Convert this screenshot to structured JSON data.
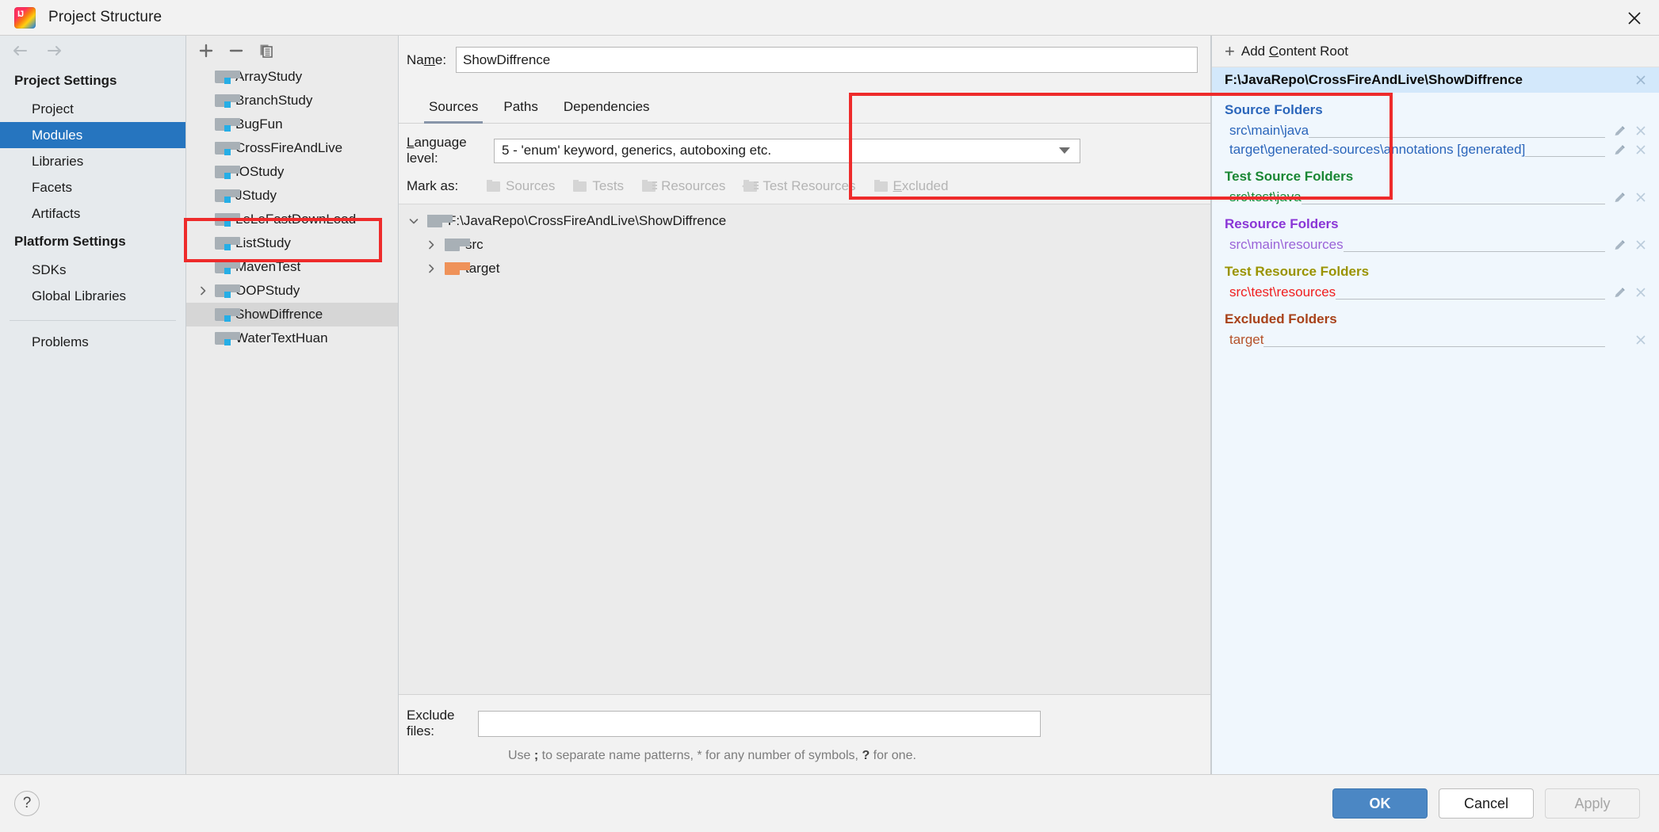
{
  "window": {
    "title": "Project Structure",
    "app_icon": "intellij-idea-icon",
    "close_icon": "close-icon"
  },
  "sidebar": {
    "nav": {
      "back_icon": "arrow-left-icon",
      "forward_icon": "arrow-right-icon"
    },
    "groups": [
      {
        "title": "Project Settings",
        "items": [
          {
            "label": "Project",
            "selected": false
          },
          {
            "label": "Modules",
            "selected": true
          },
          {
            "label": "Libraries",
            "selected": false
          },
          {
            "label": "Facets",
            "selected": false
          },
          {
            "label": "Artifacts",
            "selected": false
          }
        ]
      },
      {
        "title": "Platform Settings",
        "items": [
          {
            "label": "SDKs",
            "selected": false
          },
          {
            "label": "Global Libraries",
            "selected": false
          }
        ]
      }
    ],
    "problems": {
      "label": "Problems"
    }
  },
  "modules_panel": {
    "toolbar": [
      {
        "name": "add-module-button",
        "icon": "plus-icon"
      },
      {
        "name": "remove-module-button",
        "icon": "minus-icon"
      },
      {
        "name": "copy-module-button",
        "icon": "copy-icon"
      }
    ],
    "items": [
      {
        "label": "ArrayStudy",
        "expandable": false,
        "selected": false
      },
      {
        "label": "BranchStudy",
        "expandable": false,
        "selected": false
      },
      {
        "label": "BugFun",
        "expandable": false,
        "selected": false
      },
      {
        "label": "CrossFireAndLive",
        "expandable": false,
        "selected": false
      },
      {
        "label": "IOStudy",
        "expandable": false,
        "selected": false
      },
      {
        "label": "JStudy",
        "expandable": false,
        "selected": false
      },
      {
        "label": "LeLeFastDownLoad",
        "expandable": false,
        "selected": false
      },
      {
        "label": "ListStudy",
        "expandable": false,
        "selected": false
      },
      {
        "label": "MavenTest",
        "expandable": false,
        "selected": false
      },
      {
        "label": "OOPStudy",
        "expandable": true,
        "selected": false
      },
      {
        "label": "ShowDiffrence",
        "expandable": false,
        "selected": true
      },
      {
        "label": "WaterTextHuan",
        "expandable": false,
        "selected": false
      }
    ]
  },
  "center": {
    "name_label": "Name:",
    "name_value": "ShowDiffrence",
    "tabs": [
      {
        "label": "Sources",
        "active": true
      },
      {
        "label": "Paths",
        "active": false
      },
      {
        "label": "Dependencies",
        "active": false
      }
    ],
    "language_level_label": "Language level:",
    "language_level_value": "5 - 'enum' keyword, generics, autoboxing etc.",
    "mark_as_label": "Mark as:",
    "mark_as_options": [
      {
        "label": "Sources",
        "icon": "folder-sources-icon"
      },
      {
        "label": "Tests",
        "icon": "folder-tests-icon"
      },
      {
        "label": "Resources",
        "icon": "folder-resources-icon"
      },
      {
        "label": "Test Resources",
        "icon": "folder-test-resources-icon"
      },
      {
        "label": "Excluded",
        "icon": "folder-excluded-icon"
      }
    ],
    "tree": [
      {
        "label": "F:\\JavaRepo\\CrossFireAndLive\\ShowDiffrence",
        "depth": 0,
        "expanded": true,
        "icon": "folder-icon",
        "color": "gray"
      },
      {
        "label": "src",
        "depth": 1,
        "expanded": false,
        "icon": "folder-icon",
        "color": "gray"
      },
      {
        "label": "target",
        "depth": 1,
        "expanded": false,
        "icon": "folder-excluded-icon",
        "color": "orange"
      }
    ],
    "exclude_files_label": "Exclude files:",
    "exclude_files_value": "",
    "exclude_hint_a": "Use ",
    "exclude_hint_semicolon": ";",
    "exclude_hint_b": " to separate name patterns, * for any number of symbols, ",
    "exclude_hint_q": "?",
    "exclude_hint_c": " for one."
  },
  "right_panel": {
    "add_content_root": "Add Content Root",
    "add_icon": "plus-icon",
    "content_root": "F:\\JavaRepo\\CrossFireAndLive\\ShowDiffrence",
    "groups": [
      {
        "title": "Source Folders",
        "color": "#2b66bb",
        "entries": [
          {
            "path": "src\\main\\java",
            "color": "#2b66bb",
            "has_edit": true,
            "has_remove": true
          },
          {
            "path": "target\\generated-sources\\annotations [generated]",
            "color": "#2b66bb",
            "has_edit": true,
            "has_remove": true
          }
        ]
      },
      {
        "title": "Test Source Folders",
        "color": "#1a8734",
        "entries": [
          {
            "path": "src\\test\\java",
            "color": "#1a8734",
            "has_edit": true,
            "has_remove": true
          }
        ]
      },
      {
        "title": "Resource Folders",
        "color": "#8a35d6",
        "entries": [
          {
            "path": "src\\main\\resources",
            "color": "#9a63d8",
            "has_edit": true,
            "has_remove": true
          }
        ]
      },
      {
        "title": "Test Resource Folders",
        "color": "#9a9300",
        "entries": [
          {
            "path": "src\\test\\resources",
            "color": "#f01e1e",
            "has_edit": true,
            "has_remove": true
          }
        ]
      },
      {
        "title": "Excluded Folders",
        "color": "#a8421a",
        "entries": [
          {
            "path": "target",
            "color": "#b5522a",
            "has_edit": false,
            "has_remove": true
          }
        ]
      }
    ]
  },
  "footer": {
    "help_label": "?",
    "ok_label": "OK",
    "cancel_label": "Cancel",
    "apply_label": "Apply"
  },
  "annotations": {
    "highlight_color": "#ee2b2b",
    "boxes": [
      {
        "name": "modules-highlight",
        "target": "ShowDiffrence / WaterTextHuan module rows"
      },
      {
        "name": "sources-tab-highlight",
        "target": "Sources tab, Language level, Mark as row"
      }
    ]
  }
}
